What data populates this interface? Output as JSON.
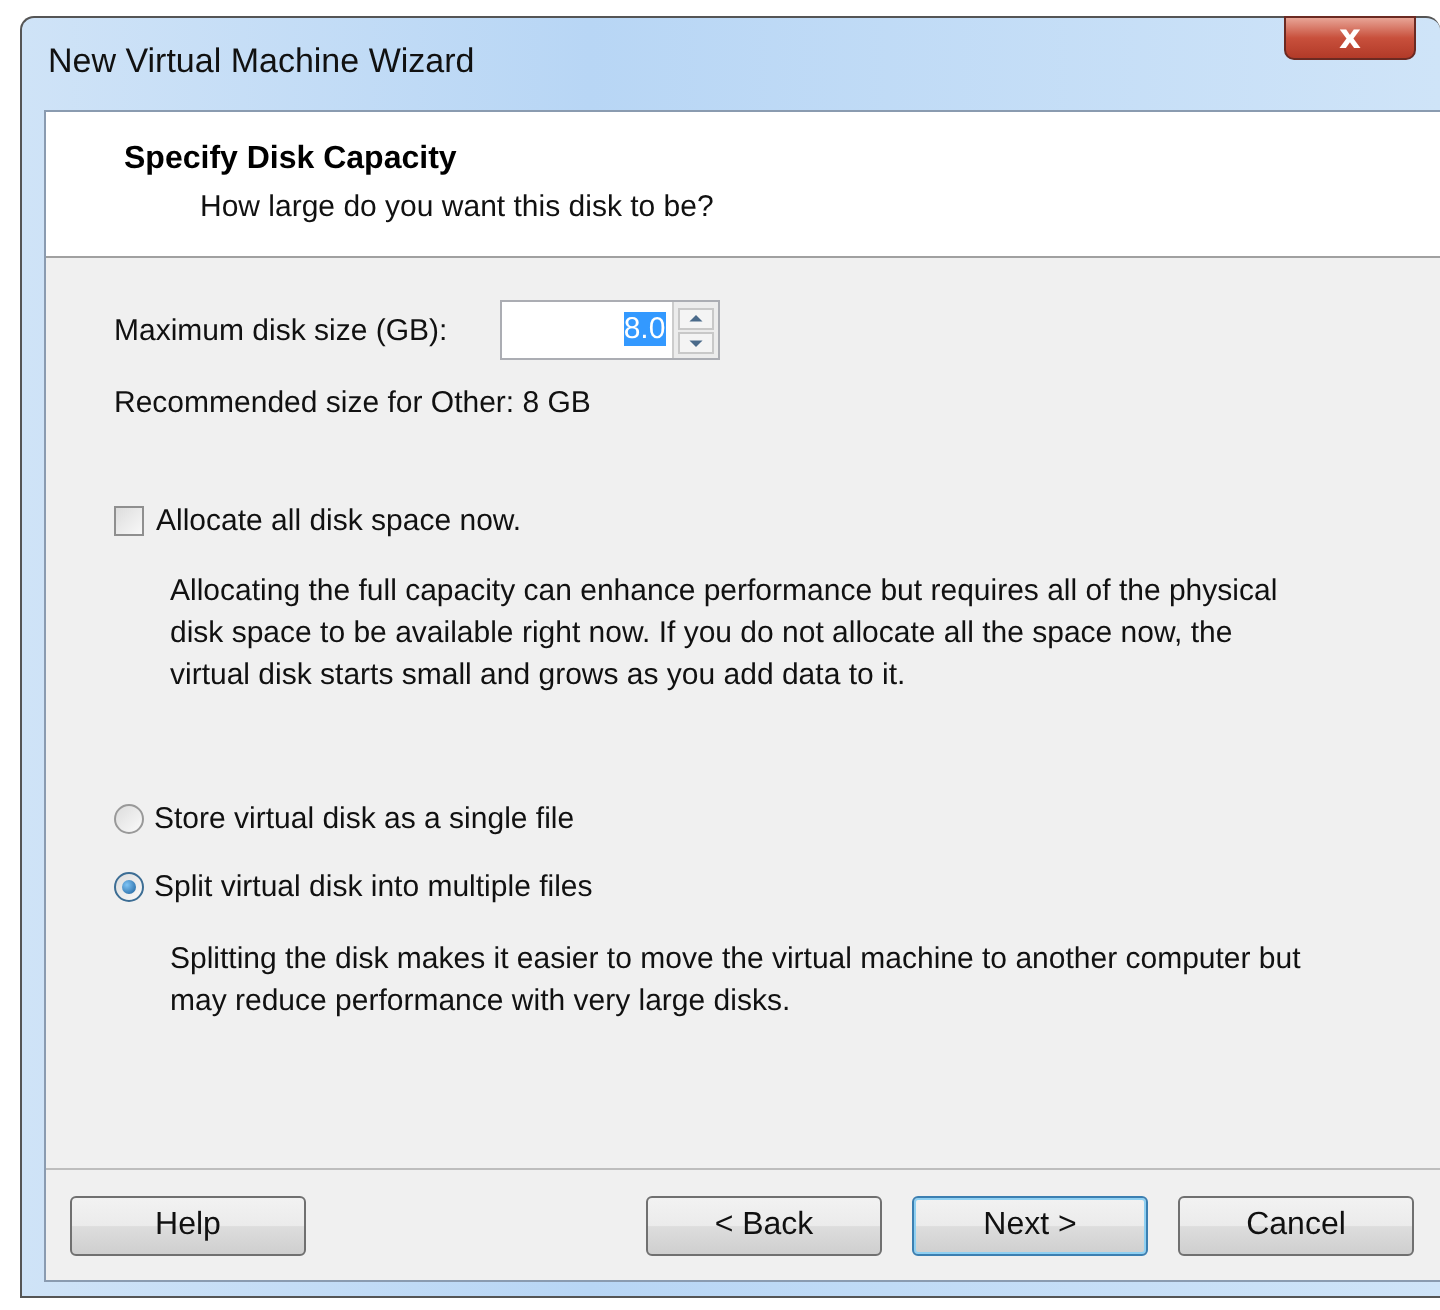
{
  "window": {
    "title": "New Virtual Machine Wizard",
    "close": "x"
  },
  "header": {
    "title": "Specify Disk Capacity",
    "subtitle": "How large do you want this disk to be?"
  },
  "disk_size": {
    "label": "Maximum disk size (GB):",
    "value": "8.0",
    "value_selected": true
  },
  "recommended": "Recommended size for Other: 8 GB",
  "allocate": {
    "label": "Allocate all disk space now.",
    "checked": false,
    "description": "Allocating the full capacity can enhance performance but requires all of the physical disk space to be available right now. If you do not allocate all the space now, the virtual disk starts small and grows as you add data to it."
  },
  "storage_options": [
    {
      "label": "Store virtual disk as a single file",
      "selected": false
    },
    {
      "label": "Split virtual disk into multiple files",
      "selected": true,
      "description": "Splitting the disk makes it easier to move the virtual machine to another computer but may reduce performance with very large disks."
    }
  ],
  "buttons": [
    {
      "label": "Help",
      "kind": "left",
      "default": false
    },
    {
      "label": "< Back",
      "kind": "right",
      "default": false
    },
    {
      "label": "Next >",
      "kind": "right",
      "default": true
    },
    {
      "label": "Cancel",
      "kind": "right",
      "default": false
    }
  ]
}
